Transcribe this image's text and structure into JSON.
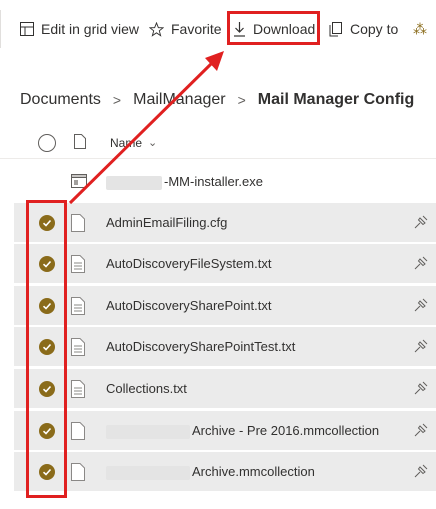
{
  "toolbar": {
    "edit_grid": "Edit in grid view",
    "favorite": "Favorite",
    "download": "Download",
    "copy_to": "Copy to",
    "more_glyph": "⁂"
  },
  "breadcrumb": {
    "items": [
      "Documents",
      "MailManager",
      "Mail Manager Config"
    ],
    "separator": ">"
  },
  "list": {
    "header_name": "Name",
    "header_sort": "⌄",
    "files": [
      {
        "name": "-MM-installer.exe",
        "selected": false,
        "icon": "exe-file-icon"
      },
      {
        "name": "AdminEmailFiling.cfg",
        "selected": true,
        "icon": "blank-file-icon"
      },
      {
        "name": "AutoDiscoveryFileSystem.txt",
        "selected": true,
        "icon": "text-file-icon"
      },
      {
        "name": "AutoDiscoverySharePoint.txt",
        "selected": true,
        "icon": "text-file-icon"
      },
      {
        "name": "AutoDiscoverySharePointTest.txt",
        "selected": true,
        "icon": "text-file-icon"
      },
      {
        "name": "Collections.txt",
        "selected": true,
        "icon": "text-file-icon"
      },
      {
        "name": "Archive - Pre 2016.mmcollection",
        "selected": true,
        "icon": "blank-file-icon"
      },
      {
        "name": "Archive.mmcollection",
        "selected": true,
        "icon": "blank-file-icon"
      }
    ]
  },
  "colors": {
    "annotation_red": "#e02020",
    "selected_row": "#ebebeb",
    "check_fill": "#8a6b1a"
  }
}
